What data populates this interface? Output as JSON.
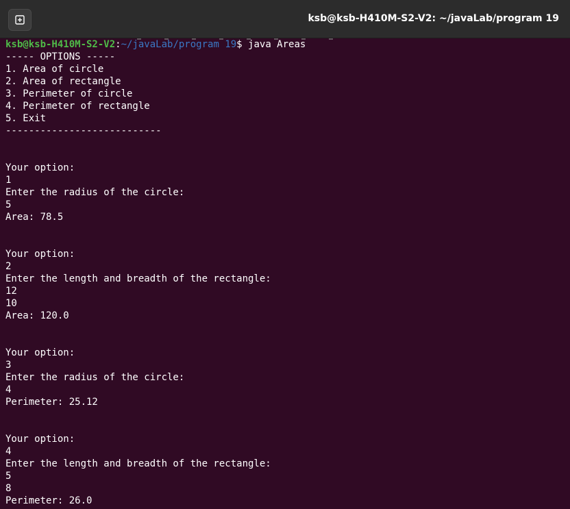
{
  "window": {
    "title": "ksb@ksb-H410M-S2-V2: ~/javaLab/program 19"
  },
  "prompt": {
    "user_host": "ksb@ksb-H410M-S2-V2",
    "colon": ":",
    "path": "~/javaLab/program 19",
    "dollar": "$ ",
    "command": "java Areas"
  },
  "lines": [
    "----- OPTIONS -----",
    "1. Area of circle",
    "2. Area of rectangle",
    "3. Perimeter of circle",
    "4. Perimeter of rectangle",
    "5. Exit",
    "---------------------------",
    "",
    "",
    "Your option:",
    "1",
    "Enter the radius of the circle:",
    "5",
    "Area: 78.5",
    "",
    "",
    "Your option:",
    "2",
    "Enter the length and breadth of the rectangle:",
    "12",
    "10",
    "Area: 120.0",
    "",
    "",
    "Your option:",
    "3",
    "Enter the radius of the circle:",
    "4",
    "Perimeter: 25.12",
    "",
    "",
    "Your option:",
    "4",
    "Enter the length and breadth of the rectangle:",
    "5",
    "8",
    "Perimeter: 26.0"
  ],
  "colors": {
    "background": "#300a24",
    "titlebar": "#2c2c2c",
    "prompt_user": "#4fba48",
    "prompt_path": "#3b78c4",
    "text": "#ffffff"
  }
}
